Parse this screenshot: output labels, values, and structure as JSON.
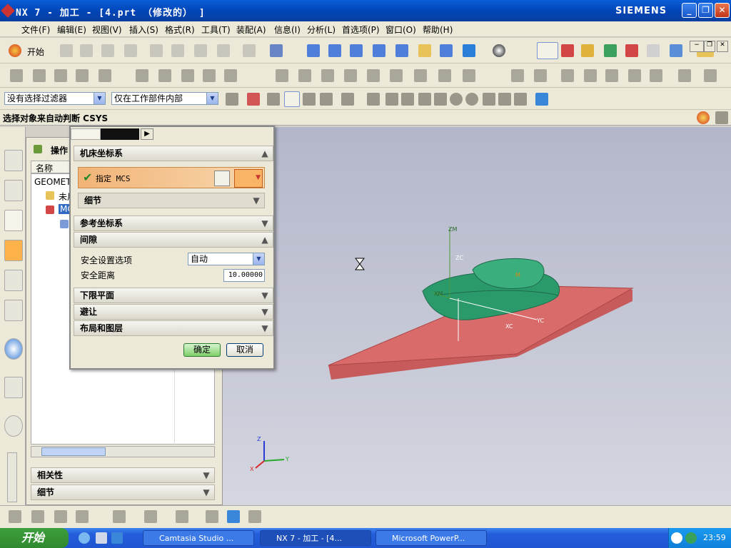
{
  "window": {
    "title": "NX 7 - 加工 - [4.prt （修改的） ]",
    "brand": "SIEMENS"
  },
  "menu": [
    "文件(F)",
    "编辑(E)",
    "视图(V)",
    "插入(S)",
    "格式(R)",
    "工具(T)",
    "装配(A)",
    "信息(I)",
    "分析(L)",
    "首选项(P)",
    "窗口(O)",
    "帮助(H)"
  ],
  "toolbar": {
    "start_label": "开始"
  },
  "selection": {
    "filter": "没有选择过滤器",
    "scope": "仅在工作部件内部"
  },
  "cue_line": "选择对象来自动判断 CSYS",
  "nav": {
    "title": "操作",
    "column_name": "名称",
    "root": "GEOMETRY",
    "unused": "未用",
    "mcs_node": "MCS",
    "section_dependencies": "相关性",
    "section_details": "细节"
  },
  "dialog": {
    "sections": {
      "machine_csys": "机床坐标系",
      "reference_csys": "参考坐标系",
      "clearance": "间隙",
      "lower_plane": "下限平面",
      "avoidance": "避让",
      "layout_layers": "布局和图层"
    },
    "specify_mcs": "指定 MCS",
    "details": "细节",
    "safety_option_label": "安全设置选项",
    "safety_option_value": "自动",
    "safety_distance_label": "安全距离",
    "safety_distance_value": "10.00000",
    "ok_label": "确定",
    "cancel_label": "取消"
  },
  "viewport_axes": {
    "z": "Z",
    "y": "Y",
    "x": "X",
    "m": "M",
    "zm": "ZM",
    "xm": "XM",
    "xc": "XC",
    "yc": "YC",
    "zc": "ZC"
  },
  "taskbar": {
    "start": "开始",
    "tasks": [
      "Camtasia Studio ...",
      "NX 7 - 加工 - [4...",
      "Microsoft PowerP..."
    ],
    "time": "23:59"
  },
  "colors": {
    "stock": "#d96b6b",
    "part": "#2b9a6b",
    "titlebar": "#0a5fd8"
  }
}
